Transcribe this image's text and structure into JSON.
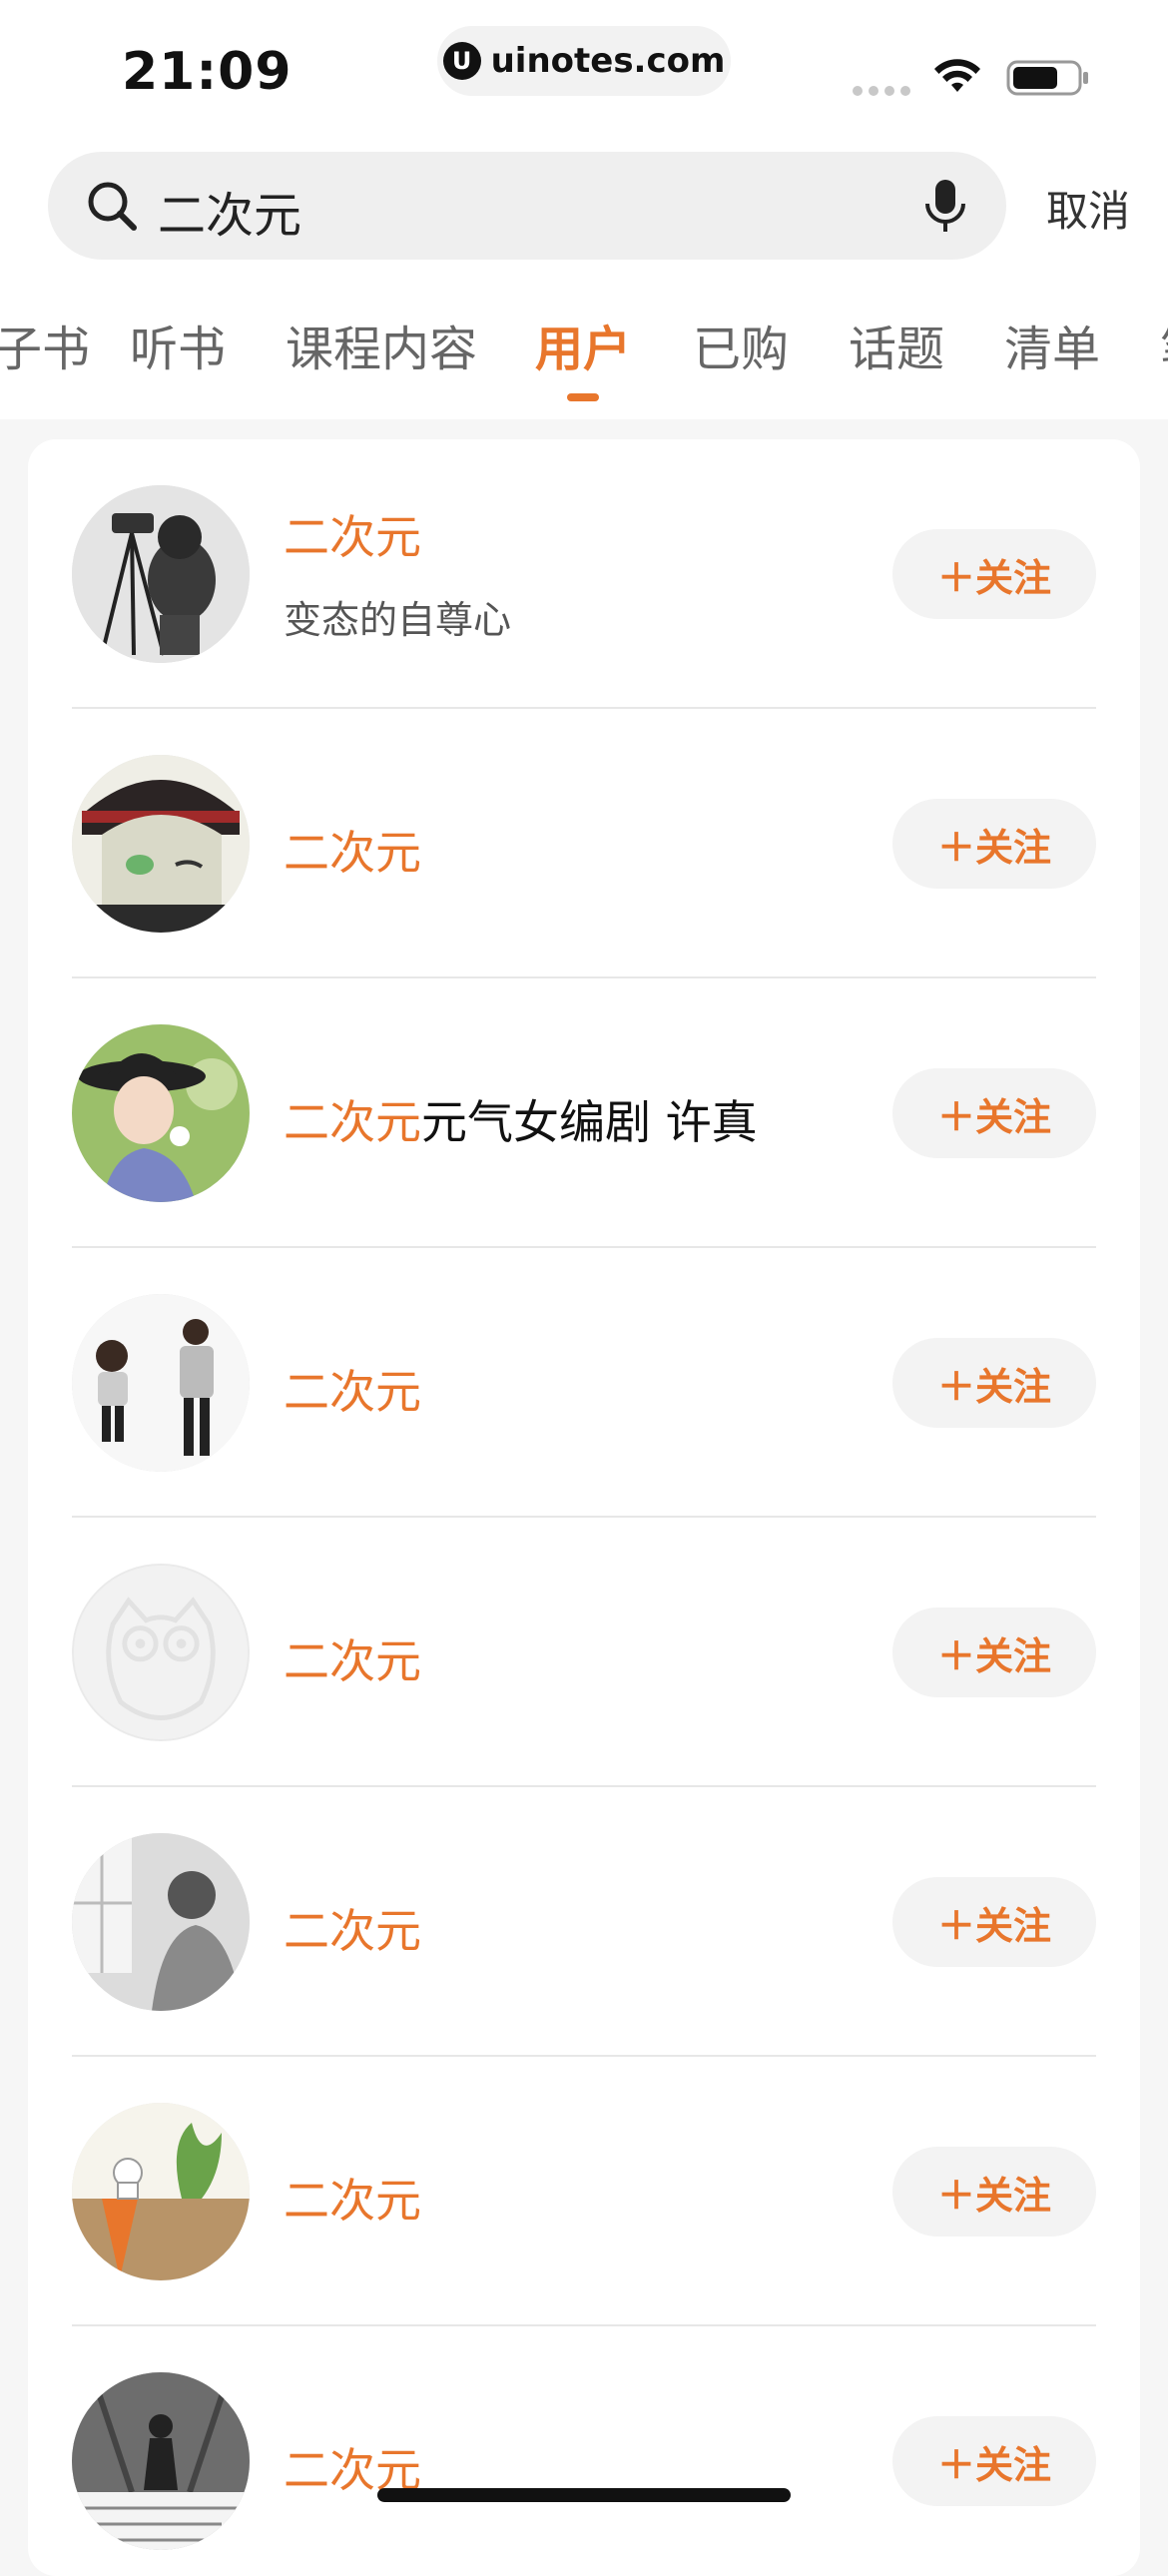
{
  "status_bar": {
    "time": "21:09",
    "url_logo": "U",
    "url": "uinotes.com"
  },
  "search": {
    "query": "二次元",
    "cancel_label": "取消"
  },
  "tabs": [
    {
      "label": "电子书"
    },
    {
      "label": "听书"
    },
    {
      "label": "课程内容"
    },
    {
      "label": "用户"
    },
    {
      "label": "已购"
    },
    {
      "label": "话题"
    },
    {
      "label": "清单"
    },
    {
      "label": "笔记"
    }
  ],
  "active_tab": "用户",
  "accent_color": "#e8762c",
  "follow_label": "＋关注",
  "users": [
    {
      "name_highlight": "二次元",
      "name_rest": "",
      "bio": "变态的自尊心",
      "avatar": "photographer-avatar"
    },
    {
      "name_highlight": "二次元",
      "name_rest": "",
      "bio": "",
      "avatar": "anime-boy-avatar"
    },
    {
      "name_highlight": "二次元",
      "name_rest": "元气女编剧 许真",
      "bio": "",
      "avatar": "woman-hat-avatar"
    },
    {
      "name_highlight": "二次元",
      "name_rest": "",
      "bio": "",
      "avatar": "cartoon-boys-avatar"
    },
    {
      "name_highlight": "二次元",
      "name_rest": "",
      "bio": "",
      "avatar": "default-owl-avatar"
    },
    {
      "name_highlight": "二次元",
      "name_rest": "",
      "bio": "",
      "avatar": "window-boy-avatar"
    },
    {
      "name_highlight": "二次元",
      "name_rest": "",
      "bio": "",
      "avatar": "carrot-avatar"
    },
    {
      "name_highlight": "二次元",
      "name_rest": "",
      "bio": "",
      "avatar": "street-girl-avatar"
    }
  ]
}
